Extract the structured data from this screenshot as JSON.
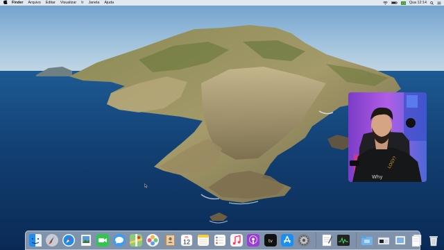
{
  "menubar": {
    "app_name": "Finder",
    "items": [
      "Arquivo",
      "Editar",
      "Visualizar",
      "Ir",
      "Janela",
      "Ajuda"
    ],
    "clock": "Qua 12:14"
  },
  "dock": {
    "calendar_month": "JUL",
    "calendar_day": "12",
    "apps": [
      {
        "name": "finder-icon"
      },
      {
        "name": "launchpad-icon"
      },
      {
        "name": "safari-icon"
      },
      {
        "name": "preview-icon"
      },
      {
        "name": "facetime-icon"
      },
      {
        "name": "messages-icon"
      },
      {
        "name": "maps-icon"
      },
      {
        "name": "photos-icon"
      },
      {
        "name": "contacts-icon"
      },
      {
        "name": "calendar-icon"
      },
      {
        "name": "notes-icon"
      },
      {
        "name": "reminders-icon"
      },
      {
        "name": "music-icon"
      },
      {
        "name": "podcasts-icon"
      },
      {
        "name": "appletv-icon"
      },
      {
        "name": "appstore-icon"
      },
      {
        "name": "system-preferences-icon"
      },
      {
        "name": "textedit-icon"
      },
      {
        "name": "activity-monitor-icon"
      }
    ],
    "right_items": [
      {
        "name": "desktop-folder-icon"
      },
      {
        "name": "downloads-stack-icon"
      },
      {
        "name": "screenshot-stack-icon"
      },
      {
        "name": "documents-stack-icon"
      },
      {
        "name": "trash-icon"
      }
    ]
  }
}
